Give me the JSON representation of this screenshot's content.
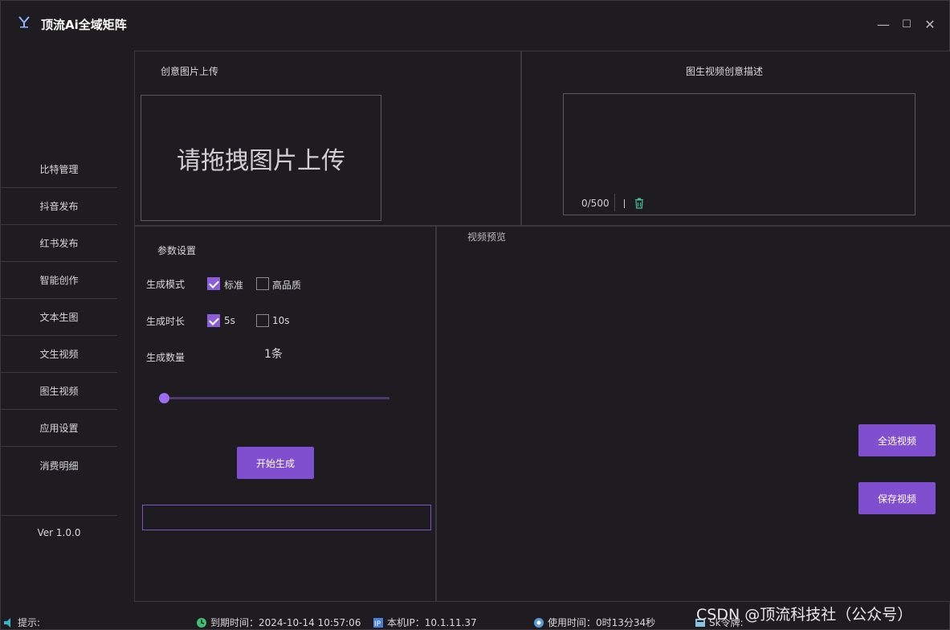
{
  "app": {
    "title": "顶流Ai全域矩阵",
    "window_controls": [
      "—",
      "☐",
      "✕"
    ]
  },
  "sidebar": {
    "items": [
      {
        "label": "比特管理"
      },
      {
        "label": "抖音发布"
      },
      {
        "label": "红书发布"
      },
      {
        "label": "智能创作"
      },
      {
        "label": "文本生图"
      },
      {
        "label": "文生视频"
      },
      {
        "label": "图生视频"
      },
      {
        "label": "应用设置"
      },
      {
        "label": "消费明细"
      }
    ],
    "version": "Ver 1.0.0"
  },
  "upload": {
    "title": "创意图片上传",
    "placeholder": "请拖拽图片上传"
  },
  "description": {
    "title": "图生视频创意描述",
    "counter": "0/500",
    "delete_icon": "trash-icon"
  },
  "params": {
    "title": "参数设置",
    "mode": {
      "label": "生成模式",
      "options": [
        {
          "label": "标准",
          "checked": true
        },
        {
          "label": "高品质",
          "checked": false
        }
      ]
    },
    "duration": {
      "label": "生成时长",
      "options": [
        {
          "label": "5s",
          "checked": true
        },
        {
          "label": "10s",
          "checked": false
        }
      ]
    },
    "count": {
      "label": "生成数量",
      "value": "1条",
      "slider_fraction": 0.0
    },
    "start_button": "开始生成"
  },
  "preview": {
    "title": "视频预览",
    "select_all_button": "全选视频",
    "save_button": "保存视频"
  },
  "status": {
    "hint": "提示:",
    "expiry": "到期时间：2024-10-14 10:57:06",
    "ip": "本机IP：10.1.11.37",
    "usage": "使用时间：0时13分34秒",
    "token": "Sk令牌:"
  },
  "watermark": "CSDN @顶流科技社（公众号）",
  "colors": {
    "accent": "#7f4fd0",
    "background": "#1e1c20",
    "border": "#3a383c"
  }
}
